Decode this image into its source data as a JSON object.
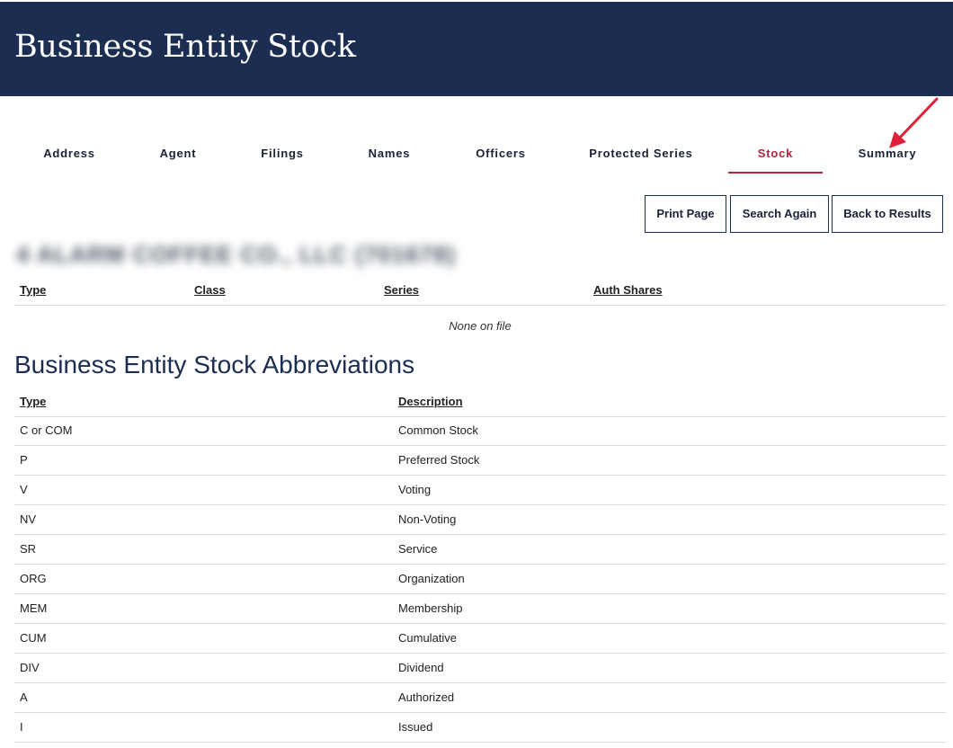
{
  "header": {
    "title": "Business Entity Stock"
  },
  "nav": {
    "tabs": [
      {
        "label": "Address",
        "active": false
      },
      {
        "label": "Agent",
        "active": false
      },
      {
        "label": "Filings",
        "active": false
      },
      {
        "label": "Names",
        "active": false
      },
      {
        "label": "Officers",
        "active": false
      },
      {
        "label": "Protected Series",
        "active": false
      },
      {
        "label": "Stock",
        "active": true
      },
      {
        "label": "Summary",
        "active": false
      }
    ]
  },
  "actions": {
    "print": "Print Page",
    "search_again": "Search Again",
    "back": "Back to Results"
  },
  "entity": {
    "name": "4 ALARM COFFEE CO., LLC (701678)"
  },
  "stock_table": {
    "headers": [
      "Type",
      "Class",
      "Series",
      "Auth Shares"
    ],
    "empty_text": "None on file"
  },
  "abbreviations": {
    "title": "Business Entity Stock Abbreviations",
    "headers": [
      "Type",
      "Description"
    ],
    "rows": [
      [
        "C or COM",
        "Common Stock"
      ],
      [
        "P",
        "Preferred Stock"
      ],
      [
        "V",
        "Voting"
      ],
      [
        "NV",
        "Non-Voting"
      ],
      [
        "SR",
        "Service"
      ],
      [
        "ORG",
        "Organization"
      ],
      [
        "MEM",
        "Membership"
      ],
      [
        "CUM",
        "Cumulative"
      ],
      [
        "DIV",
        "Dividend"
      ],
      [
        "A",
        "Authorized"
      ],
      [
        "I",
        "Issued"
      ]
    ]
  },
  "colors": {
    "header_bg": "#1c2d52",
    "active_tab": "#b2253a",
    "annotation_arrow": "#e0203a"
  }
}
